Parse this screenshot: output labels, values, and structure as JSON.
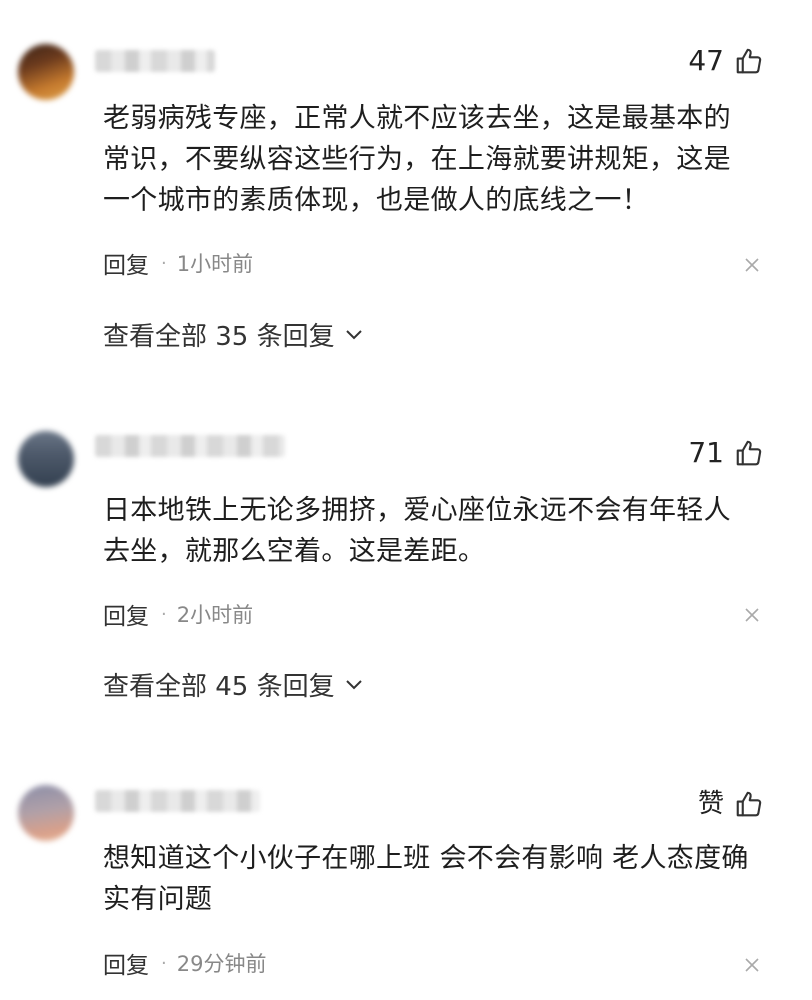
{
  "comments": [
    {
      "likes": "47",
      "text_lines": [
        "老弱病残专座，正常人就不应该去坐，这是最基本的",
        "常识，不要纵容这些行为，在上海就要讲规矩，这是",
        "一个城市的素质体现，也是做人的底线之一！"
      ],
      "reply_label": "回复",
      "dot": "·",
      "time": "1小时前",
      "view_all": "查看全部 35 条回复"
    },
    {
      "likes": "71",
      "text_lines": [
        "日本地铁上无论多拥挤，爱心座位永远不会有年轻人",
        "去坐，就那么空着。这是差距。"
      ],
      "reply_label": "回复",
      "dot": "·",
      "time": "2小时前",
      "view_all": "查看全部 45 条回复"
    },
    {
      "likes": "赞",
      "text_lines": [
        "想知道这个小伙子在哪上班 会不会有影响 老人态度确",
        "实有问题"
      ],
      "reply_label": "回复",
      "dot": "·",
      "time": "29分钟前"
    }
  ],
  "colors": {
    "text": "#1e1e1e",
    "muted": "#888888",
    "icon": "#333333"
  },
  "icons": {
    "like": "thumbs-up-icon",
    "dismiss": "close-icon",
    "expand": "chevron-down-icon"
  }
}
